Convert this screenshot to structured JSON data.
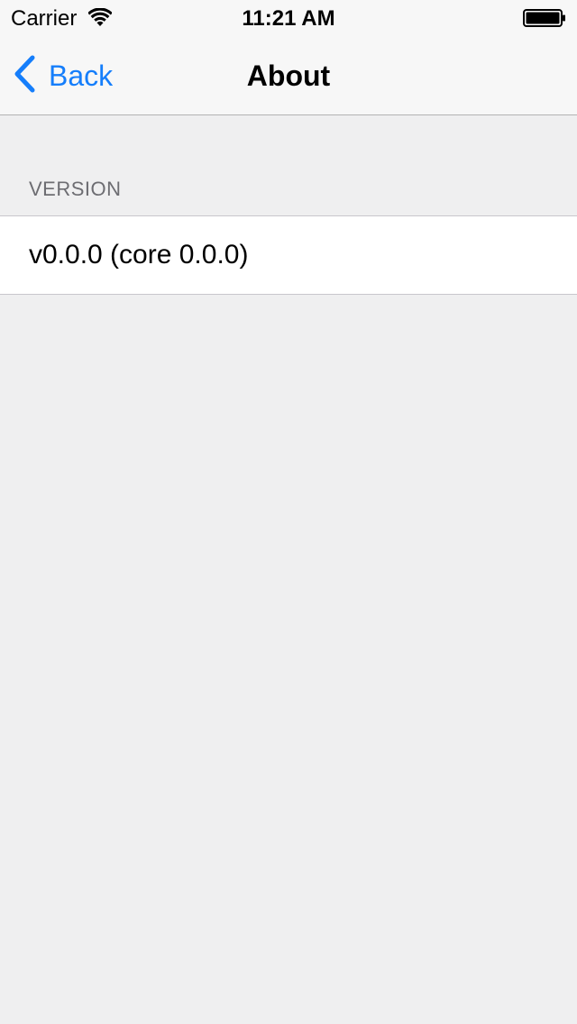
{
  "status_bar": {
    "carrier": "Carrier",
    "time": "11:21 AM",
    "wifi_icon": "wifi-icon",
    "battery_icon": "battery-icon"
  },
  "nav_bar": {
    "back_label": "Back",
    "back_icon": "chevron-left-icon",
    "title": "About",
    "accent_color": "#157efb"
  },
  "sections": [
    {
      "header": "VERSION",
      "rows": [
        {
          "text": "v0.0.0 (core 0.0.0)"
        }
      ]
    }
  ],
  "colors": {
    "background": "#efeff0",
    "bar_background": "#f7f7f7",
    "section_header": "#6d6d72"
  }
}
